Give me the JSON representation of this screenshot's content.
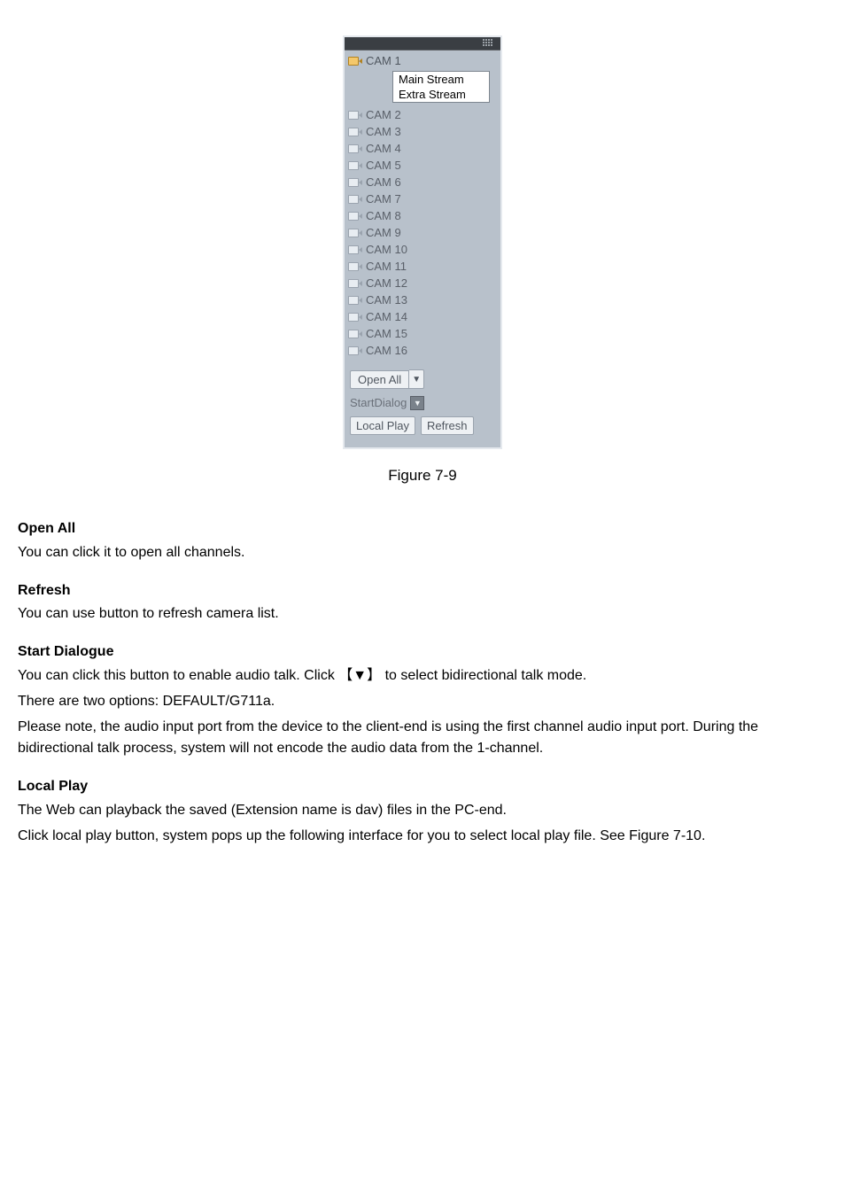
{
  "panel": {
    "cameras": [
      {
        "label": "CAM 1",
        "active": true
      },
      {
        "label": "CAM 2",
        "active": false
      },
      {
        "label": "CAM 3",
        "active": false
      },
      {
        "label": "CAM 4",
        "active": false
      },
      {
        "label": "CAM 5",
        "active": false
      },
      {
        "label": "CAM 6",
        "active": false
      },
      {
        "label": "CAM 7",
        "active": false
      },
      {
        "label": "CAM 8",
        "active": false
      },
      {
        "label": "CAM 9",
        "active": false
      },
      {
        "label": "CAM 10",
        "active": false
      },
      {
        "label": "CAM 11",
        "active": false
      },
      {
        "label": "CAM 12",
        "active": false
      },
      {
        "label": "CAM 13",
        "active": false
      },
      {
        "label": "CAM 14",
        "active": false
      },
      {
        "label": "CAM 15",
        "active": false
      },
      {
        "label": "CAM 16",
        "active": false
      }
    ],
    "stream_menu": {
      "main": "Main Stream",
      "extra": "Extra Stream"
    },
    "actions": {
      "open_all": "Open All",
      "start_dialog": "StartDialog",
      "local_play": "Local Play",
      "refresh": "Refresh"
    }
  },
  "figure_caption": "Figure 7-9",
  "sections": {
    "open_all": {
      "heading": "Open All",
      "body": "You can click it to open all channels."
    },
    "refresh": {
      "heading": "Refresh",
      "body": "You can use button to refresh camera list."
    },
    "start_dialogue": {
      "heading": "Start Dialogue",
      "line1": "You can click this button to enable audio talk. Click 【▼】 to select bidirectional talk mode.",
      "line2": "There are two options: DEFAULT/G711a.",
      "line3": "Please note, the audio input port from the device to the client-end is using the first channel audio input port. During the bidirectional talk process, system will not encode the audio data from the 1-channel."
    },
    "local_play": {
      "heading": "Local Play",
      "line1": "The Web can playback the saved (Extension name is dav) files in the PC-end.",
      "line2": "Click local play button, system pops up the following interface for you to select local play file. See Figure 7-10."
    }
  }
}
